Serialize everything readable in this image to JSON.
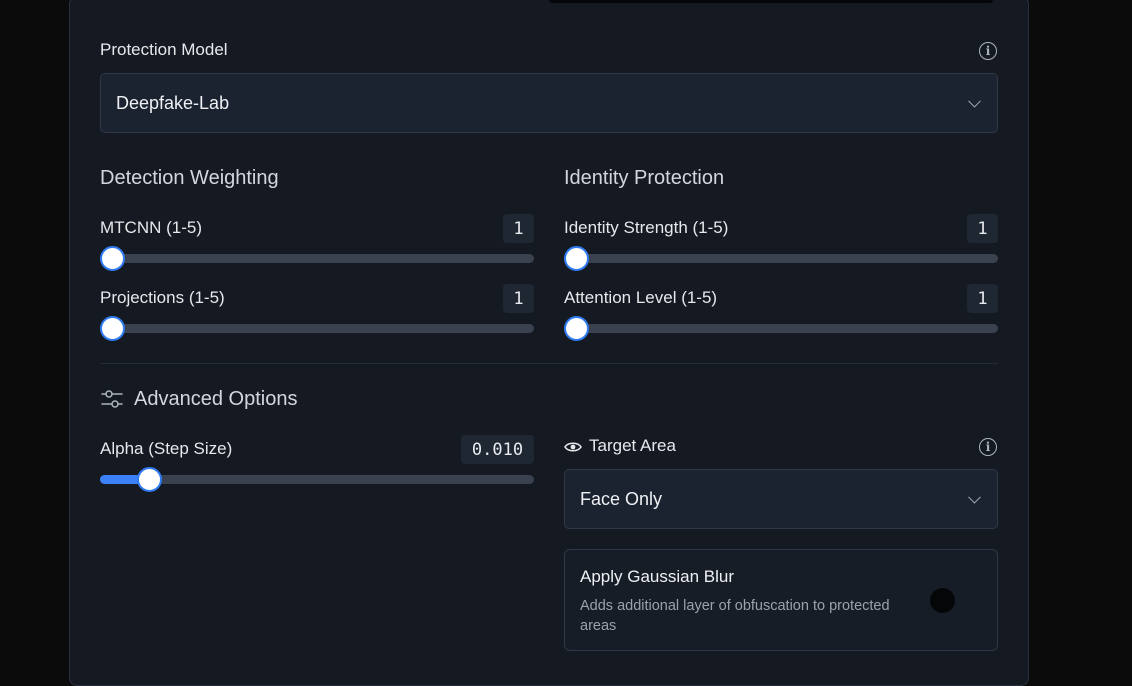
{
  "protection_model": {
    "label": "Protection Model",
    "value": "Deepfake-Lab",
    "info_icon": "info-icon"
  },
  "detection_weighting": {
    "title": "Detection Weighting",
    "mtcnn": {
      "label": "MTCNN (1-5)",
      "value": "1",
      "slider_fraction": 0
    },
    "projections": {
      "label": "Projections (1-5)",
      "value": "1",
      "slider_fraction": 0
    }
  },
  "identity_protection": {
    "title": "Identity Protection",
    "identity_strength": {
      "label": "Identity Strength (1-5)",
      "value": "1",
      "slider_fraction": 0
    },
    "attention_level": {
      "label": "Attention Level (1-5)",
      "value": "1",
      "slider_fraction": 0
    }
  },
  "advanced": {
    "title": "Advanced Options",
    "icon": "sliders-icon",
    "alpha": {
      "label": "Alpha (Step Size)",
      "value": "0.010",
      "slider_fraction": 0.115
    }
  },
  "target_area": {
    "label": "Target Area",
    "icon": "eye-icon",
    "info_icon": "info-icon",
    "value": "Face Only"
  },
  "gaussian_blur": {
    "title": "Apply Gaussian Blur",
    "description": "Adds additional layer of obfuscation to protected areas",
    "enabled": false
  },
  "colors": {
    "accent": "#3b82f6",
    "panel": "#151a22",
    "track": "#3a4250"
  }
}
